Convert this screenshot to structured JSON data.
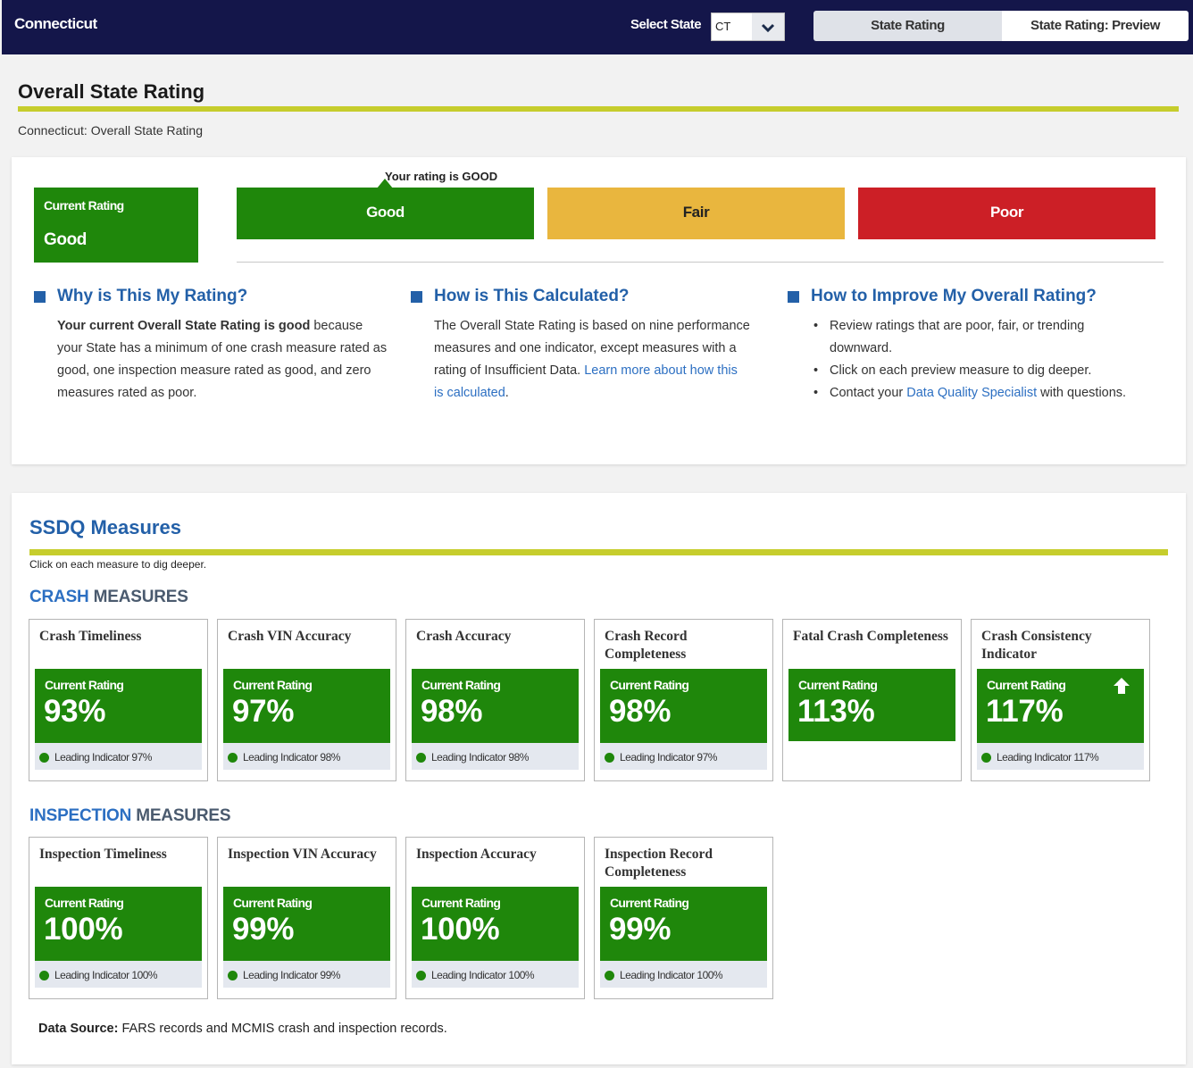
{
  "header": {
    "state_name": "Connecticut",
    "select_label": "Select State",
    "selected_state": "CT",
    "tabs": [
      "State Rating",
      "State Rating: Preview"
    ]
  },
  "page": {
    "title": "Overall State Rating",
    "breadcrumb": "Connecticut: Overall State Rating"
  },
  "rating": {
    "current_label": "Current Rating",
    "current_value": "Good",
    "your_rating_text": "Your rating is GOOD",
    "scale": [
      "Good",
      "Fair",
      "Poor"
    ],
    "colors": {
      "good": "#1f870b",
      "fair": "#e9b63e",
      "poor": "#cc1f26",
      "accent": "#c6cd2d",
      "link": "#2360a8"
    }
  },
  "info": {
    "why": {
      "heading": "Why is This My Rating?",
      "bold": "Your current Overall State Rating is good",
      "text": " because your State has a minimum of one crash measure rated as good, one inspection measure rated as good, and zero measures rated as poor."
    },
    "how": {
      "heading": "How is This Calculated?",
      "text": "The Overall State Rating is based on nine performance measures and one indicator, except measures with a rating of Insufficient Data. ",
      "link": "Learn more about how this is calculated",
      "end": "."
    },
    "improve": {
      "heading": "How to Improve My Overall Rating?",
      "item1": "Review ratings that are poor, fair, or trending downward.",
      "item2": "Click on each preview measure to dig deeper.",
      "item3_pre": "Contact your ",
      "item3_link": "Data Quality Specialist",
      "item3_post": " with questions."
    }
  },
  "measures": {
    "title": "SSDQ Measures",
    "hint": "Click on each measure to dig deeper.",
    "crash_accent": "CRASH",
    "inspection_accent": "INSPECTION",
    "group_suffix": " MEASURES",
    "current_label": "Current Rating",
    "crash": [
      {
        "name": "Crash Timeliness",
        "value": "93%",
        "lead": "Leading Indicator 97%"
      },
      {
        "name": "Crash VIN Accuracy",
        "value": "97%",
        "lead": "Leading Indicator 98%"
      },
      {
        "name": "Crash Accuracy",
        "value": "98%",
        "lead": "Leading Indicator 98%"
      },
      {
        "name": "Crash Record Completeness",
        "value": "98%",
        "lead": "Leading Indicator 97%"
      },
      {
        "name": "Fatal Crash Completeness",
        "value": "113%",
        "lead": ""
      },
      {
        "name": "Crash Consistency Indicator",
        "value": "117%",
        "lead": "Leading Indicator 117%"
      }
    ],
    "inspection": [
      {
        "name": "Inspection Timeliness",
        "value": "100%",
        "lead": "Leading Indicator 100%"
      },
      {
        "name": "Inspection VIN Accuracy",
        "value": "99%",
        "lead": "Leading Indicator 99%"
      },
      {
        "name": "Inspection Accuracy",
        "value": "100%",
        "lead": "Leading Indicator 100%"
      },
      {
        "name": "Inspection Record Completeness",
        "value": "99%",
        "lead": "Leading Indicator 100%"
      }
    ],
    "data_source_label": "Data Source:",
    "data_source_text": " FARS records and MCMIS crash and inspection records."
  }
}
